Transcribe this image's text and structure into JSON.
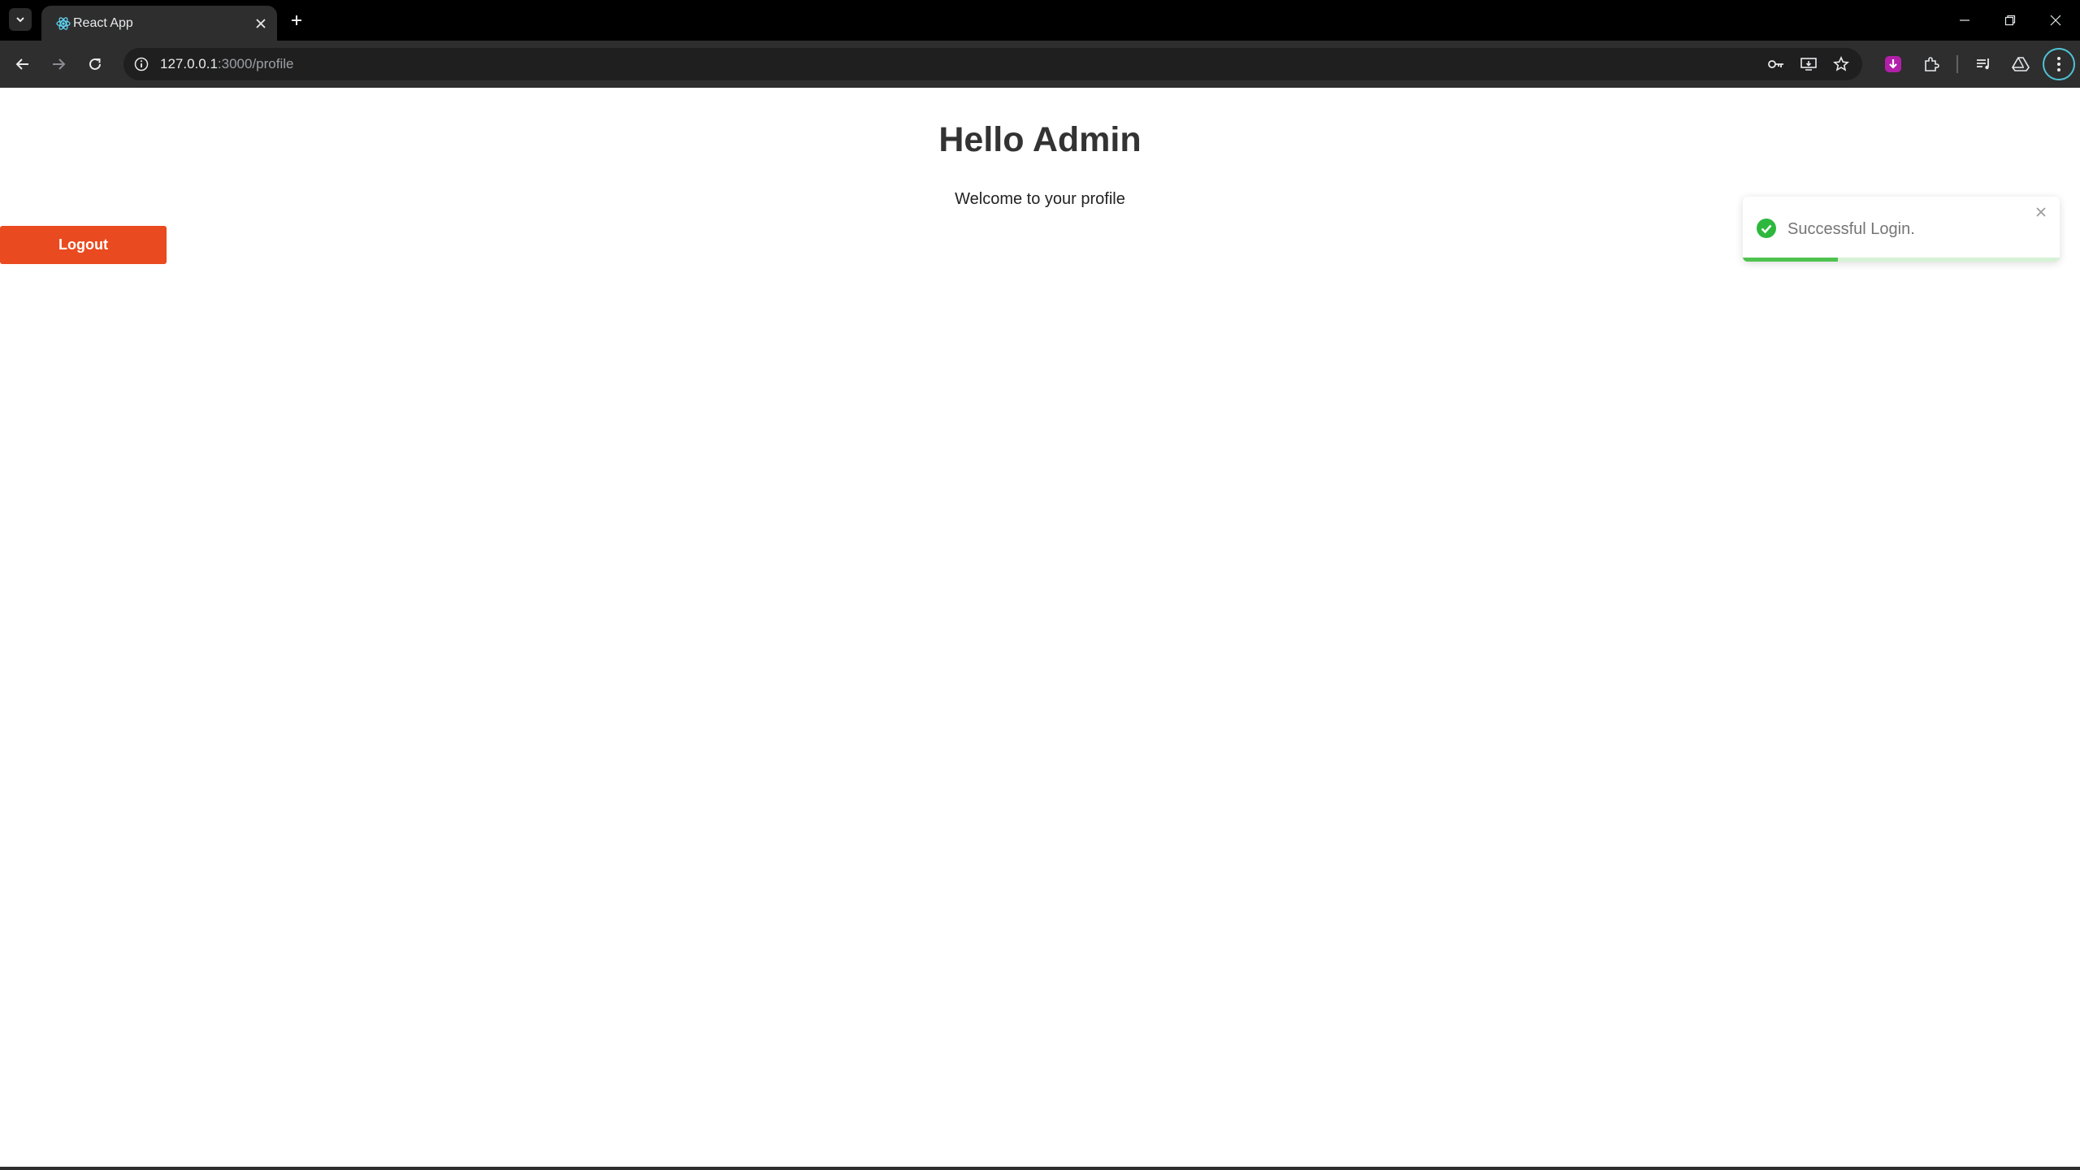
{
  "browser": {
    "tab_title": "React App",
    "url_host": "127.0.0.1",
    "url_path": ":3000/profile",
    "icons": {
      "tab_search": "chevron-down-icon",
      "favicon": "react-logo-icon",
      "tab_close": "close-icon",
      "new_tab": "plus-icon",
      "back": "arrow-left-icon",
      "forward": "arrow-right-icon",
      "reload": "reload-icon",
      "site_info": "info-icon",
      "password": "key-icon",
      "install": "install-app-icon",
      "bookmark": "star-icon",
      "download_ext": "download-extension-icon",
      "extensions": "puzzle-icon",
      "media": "media-controls-icon",
      "drive": "drive-icon",
      "menu": "kebab-menu-icon"
    }
  },
  "page": {
    "greeting": "Hello Admin",
    "welcome": "Welcome to your profile",
    "logout_label": "Logout"
  },
  "toast": {
    "message": "Successful Login.",
    "progress_fraction": 0.3,
    "icon": "check-circle-icon"
  },
  "colors": {
    "logout_button": "#ea4a1f",
    "toast_success": "#4fc34f",
    "toast_track": "#d6f2d6",
    "heading_text": "#333333",
    "chrome_dark": "#2e2e2e"
  }
}
